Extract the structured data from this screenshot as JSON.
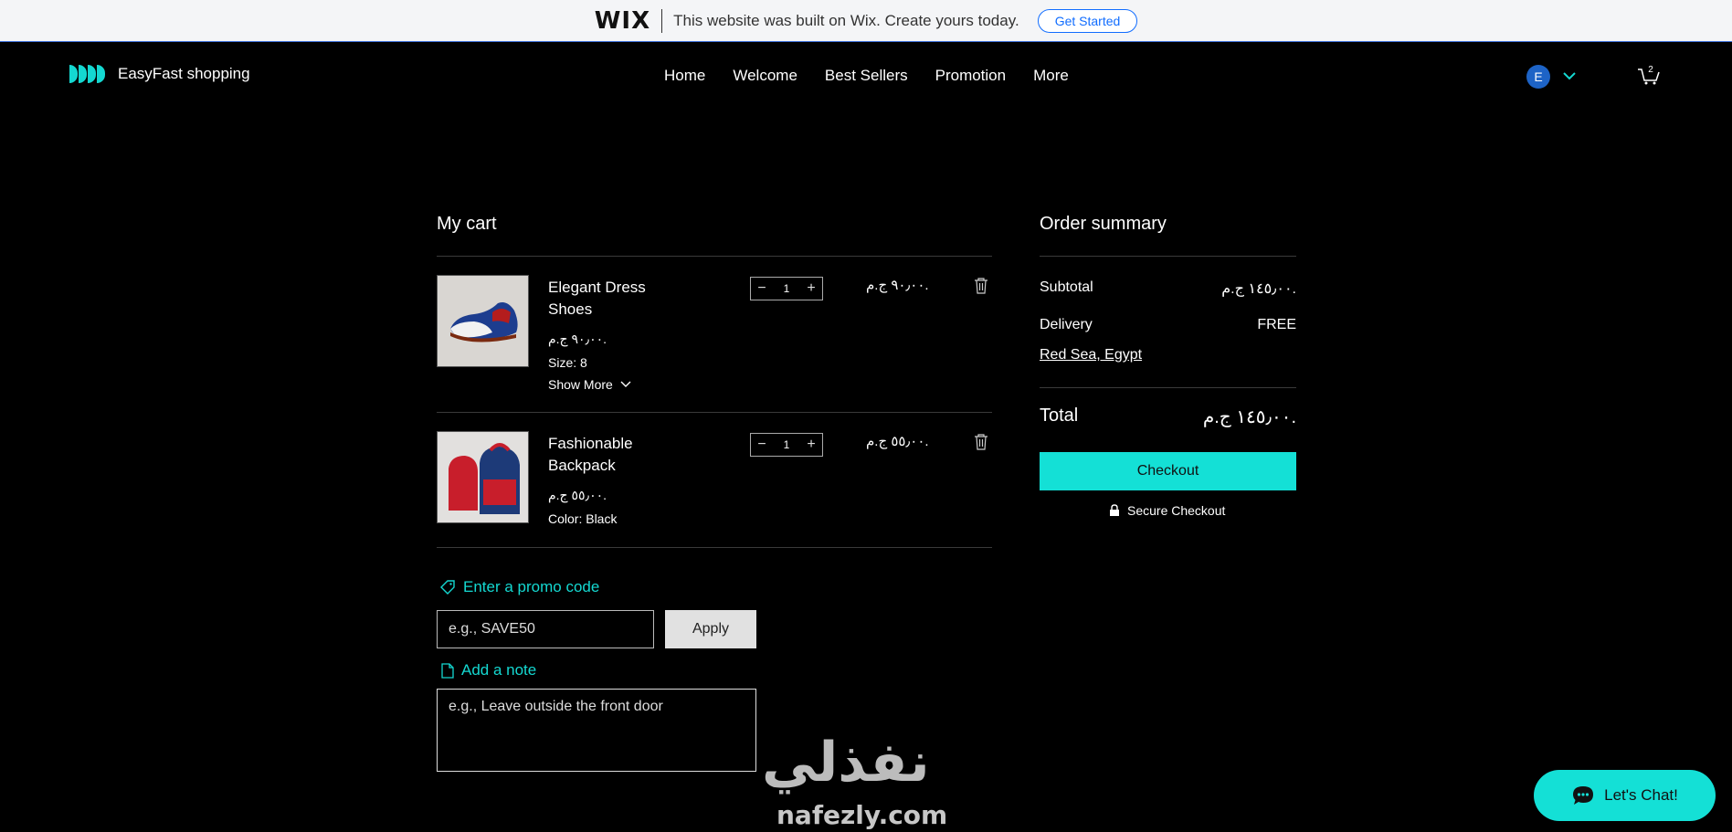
{
  "wix_banner": {
    "logo": "WIX",
    "text": "This website was built on Wix. Create yours today.",
    "button": "Get Started"
  },
  "header": {
    "brand": "EasyFast shopping",
    "nav": [
      "Home",
      "Welcome",
      "Best Sellers",
      "Promotion",
      "More"
    ],
    "avatar_initial": "E",
    "cart_count": "2"
  },
  "cart": {
    "title": "My cart",
    "items": [
      {
        "name": "Elegant Dress Shoes",
        "price": "٩٠٫٠٠ ج.م.",
        "options": [
          "Size: 8"
        ],
        "show_more": "Show More",
        "quantity": "1",
        "line_total": "٩٠٫٠٠ ج.م."
      },
      {
        "name": "Fashionable Backpack",
        "price": "٥٥٫٠٠ ج.م.",
        "options": [
          "Color: Black"
        ],
        "quantity": "1",
        "line_total": "٥٥٫٠٠ ج.م."
      }
    ],
    "promo_link": "Enter a promo code",
    "promo_placeholder": "e.g., SAVE50",
    "apply_label": "Apply",
    "note_link": "Add a note",
    "note_placeholder": "e.g., Leave outside the front door"
  },
  "summary": {
    "title": "Order summary",
    "subtotal_label": "Subtotal",
    "subtotal_value": "١٤٥٫٠٠ ج.م.",
    "delivery_label": "Delivery",
    "delivery_value": "FREE",
    "location": "Red Sea, Egypt",
    "total_label": "Total",
    "total_value": "١٤٥٫٠٠ ج.م.",
    "checkout_label": "Checkout",
    "secure_label": "Secure Checkout"
  },
  "watermark": {
    "arabic": "نفذلي",
    "domain": "nafezly.com"
  },
  "chat": {
    "label": "Let's Chat!"
  },
  "colors": {
    "accent": "#14e0d6",
    "background": "#000000",
    "avatar": "#1d63c6",
    "wix_blue": "#116dff"
  }
}
